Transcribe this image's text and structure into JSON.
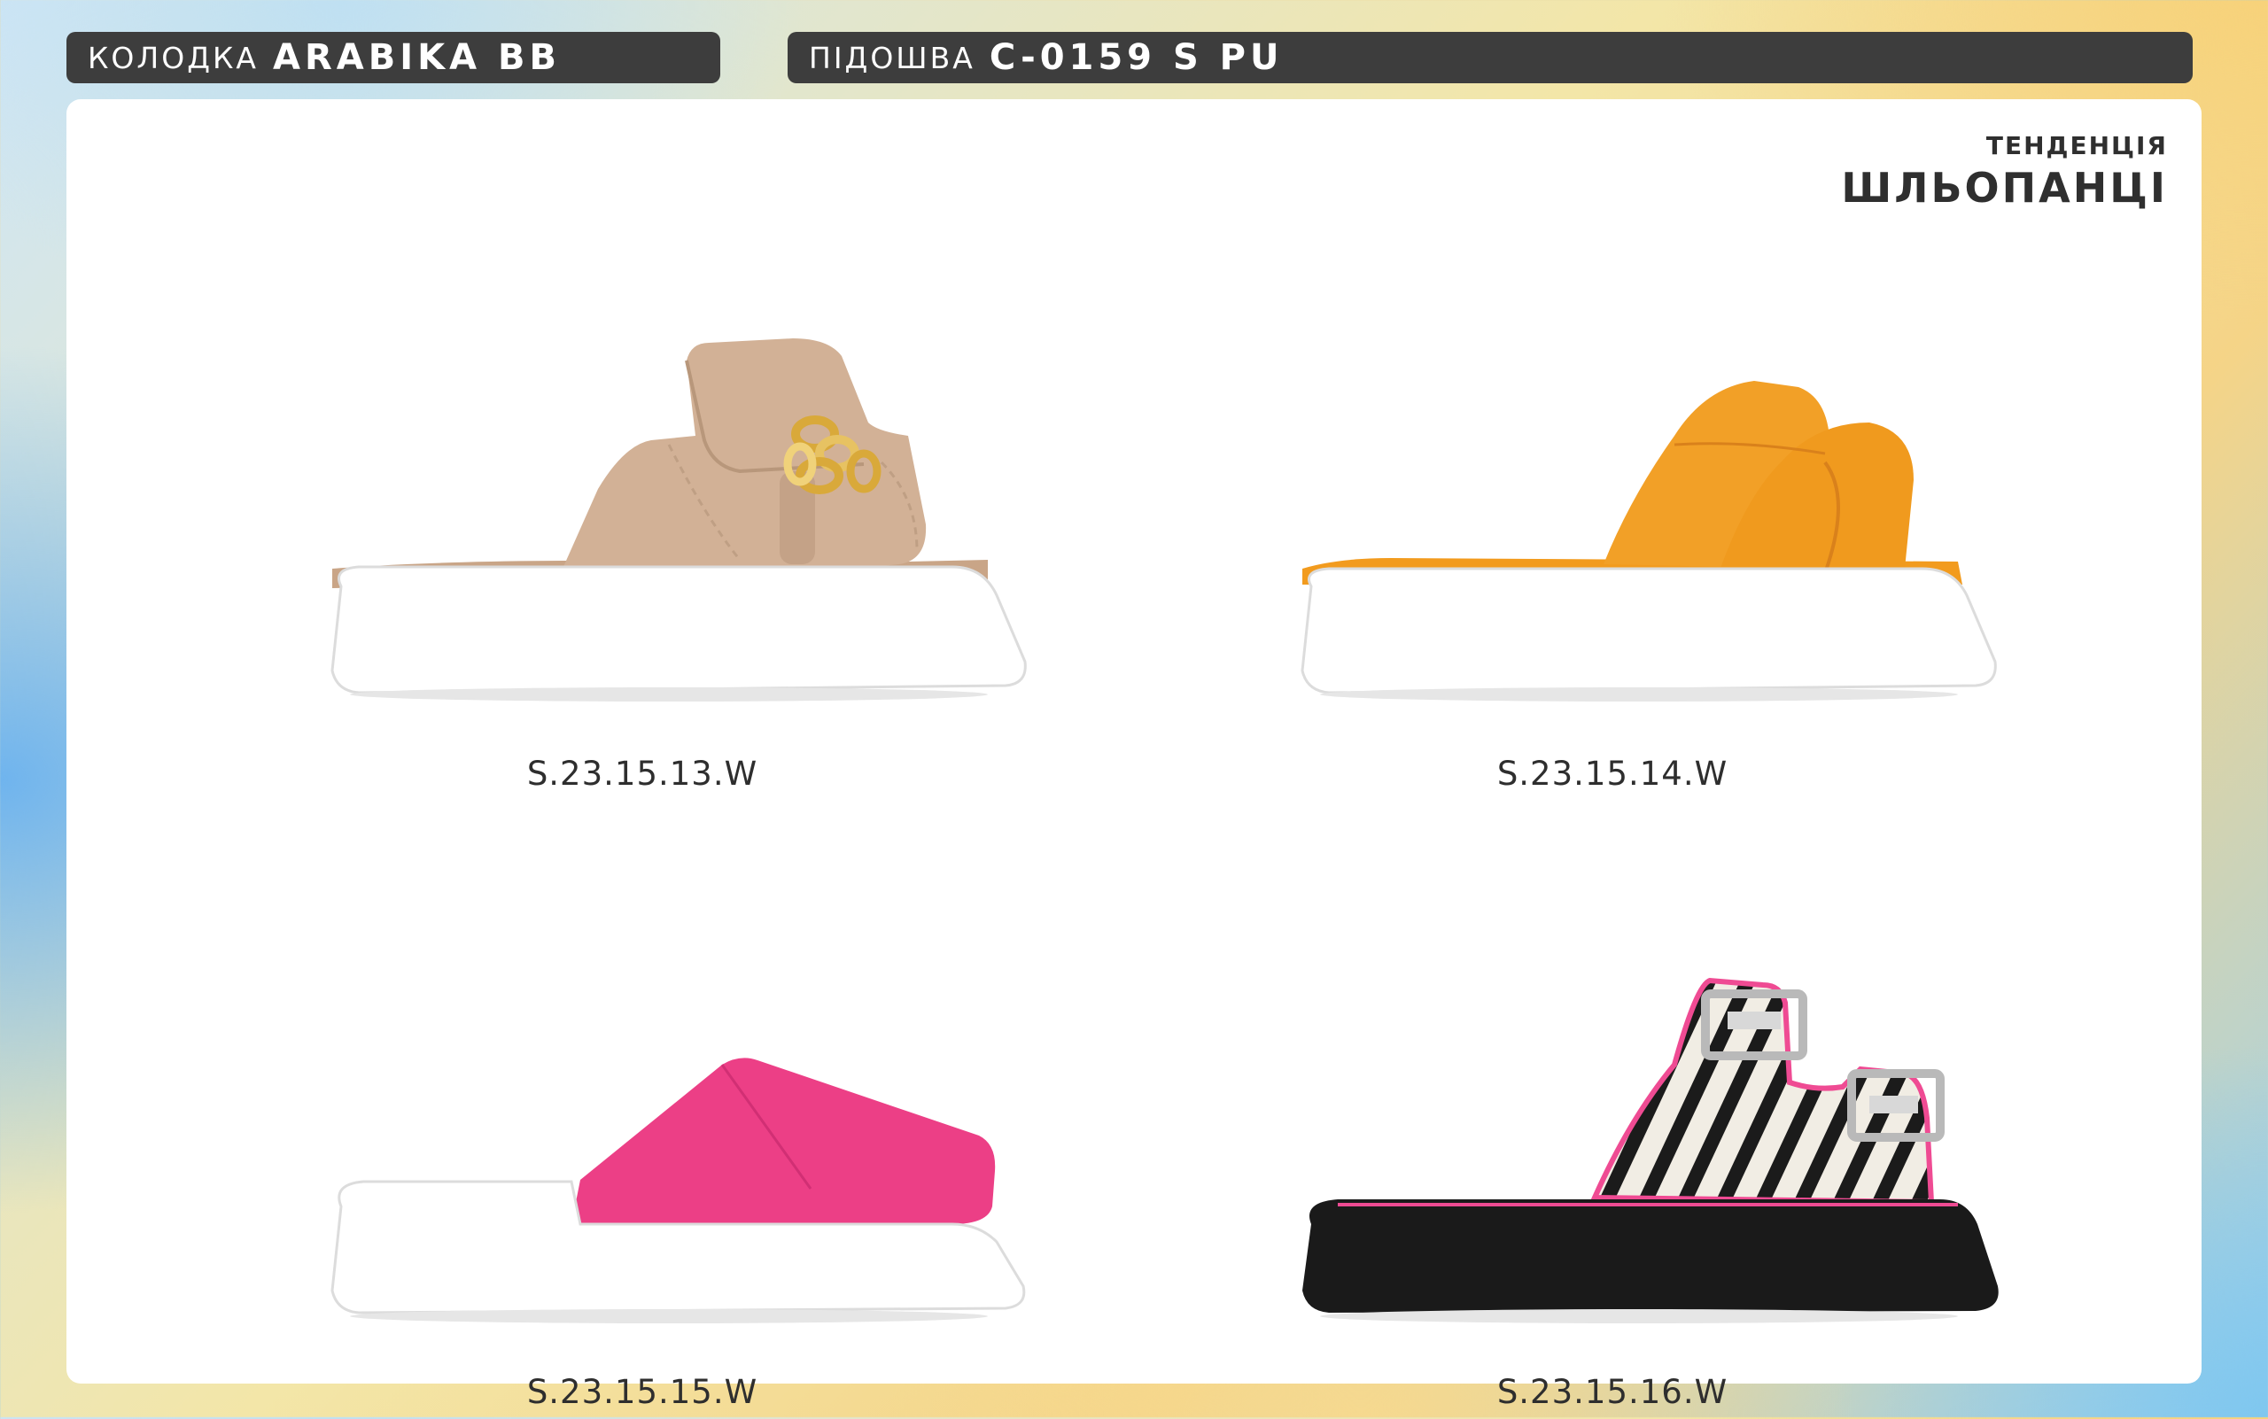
{
  "header": {
    "last": {
      "label": "КОЛОДКА",
      "value": "ARABIKA BB"
    },
    "sole": {
      "label": "ПІДОШВА",
      "value": "C-0159 S PU"
    }
  },
  "trend": {
    "kicker": "ТЕНДЕНЦІЯ",
    "title": "ШЛЬОПАНЦІ"
  },
  "products": [
    {
      "sku": "S.23.15.13.W",
      "image": "beige-suede-chain-slide-image",
      "upper_color": "#d2b196"
    },
    {
      "sku": "S.23.15.14.W",
      "image": "orange-puffy-slide-image",
      "upper_color": "#f09a1e"
    },
    {
      "sku": "S.23.15.15.W",
      "image": "pink-leather-slide-image",
      "upper_color": "#ec3f86"
    },
    {
      "sku": "S.23.15.16.W",
      "image": "zebra-buckle-slide-image",
      "upper_color": "#1b1b1b"
    }
  ]
}
